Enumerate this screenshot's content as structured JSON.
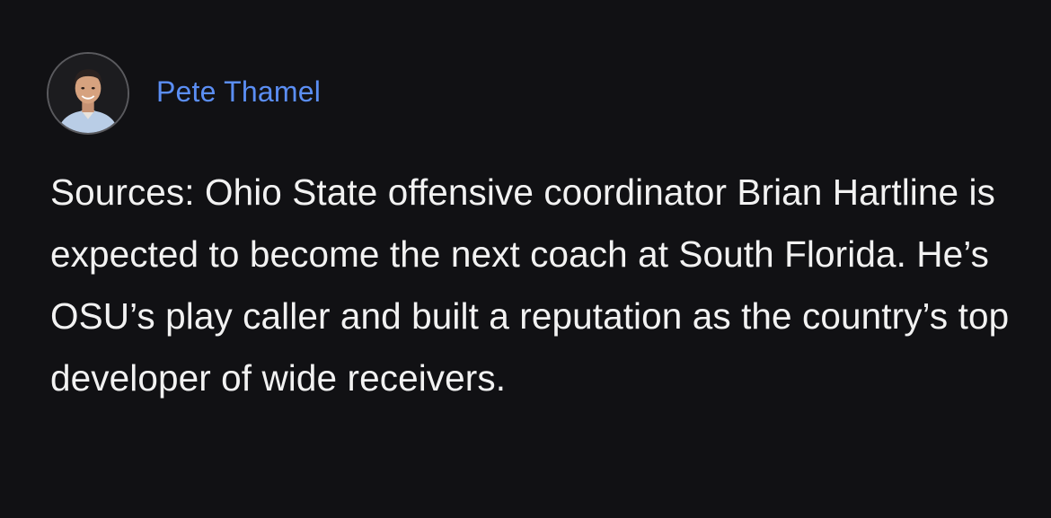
{
  "post": {
    "author": "Pete Thamel",
    "avatar_icon": "person-avatar",
    "text": "Sources: Ohio State offensive coordinator Brian Hartline is expected to become the next coach at South Florida. He’s OSU’s play caller and built a reputation as the country’s top developer of wide receivers."
  },
  "colors": {
    "background": "#111114",
    "author_name": "#5b8ef4",
    "body_text": "#f2f2f2"
  }
}
